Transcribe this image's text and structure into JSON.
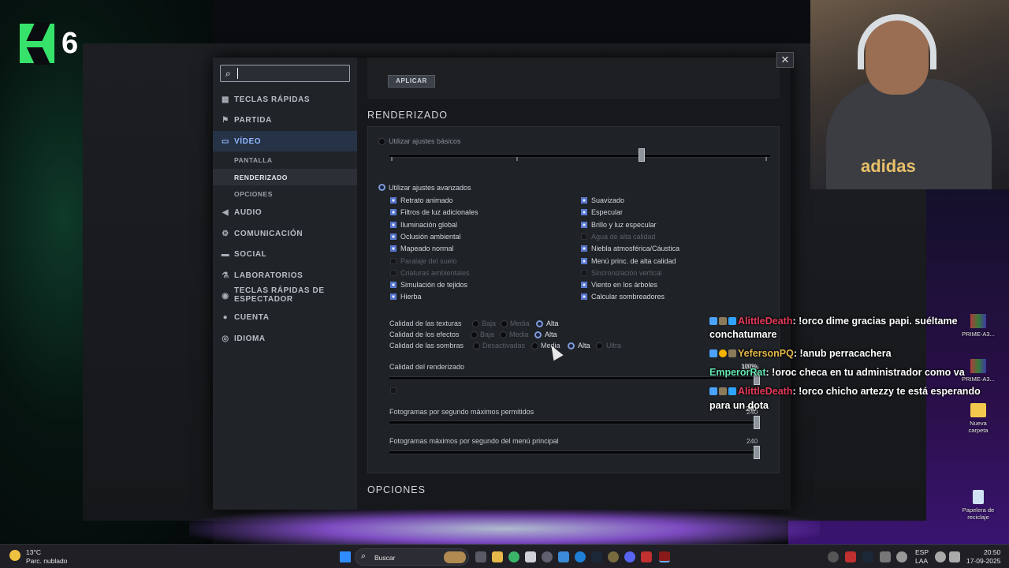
{
  "overlay": {
    "k_number": "6"
  },
  "window": {
    "close_glyph": "✕"
  },
  "sidebar": {
    "search": {
      "placeholder": "",
      "value": ""
    },
    "items": [
      {
        "label": "TECLAS RÁPIDAS",
        "icon": "grid-icon",
        "glyph": "▦"
      },
      {
        "label": "PARTIDA",
        "icon": "flag-icon",
        "glyph": "⚑"
      },
      {
        "label": "VÍDEO",
        "icon": "monitor-icon",
        "glyph": "▭"
      },
      {
        "label": "AUDIO",
        "icon": "speaker-icon",
        "glyph": "◀"
      },
      {
        "label": "COMUNICACIÓN",
        "icon": "gear-icon",
        "glyph": "⚙"
      },
      {
        "label": "SOCIAL",
        "icon": "chat-icon",
        "glyph": "▬"
      },
      {
        "label": "LABORATORIOS",
        "icon": "flask-icon",
        "glyph": "⚗"
      },
      {
        "label": "TECLAS RÁPIDAS DE",
        "label2": "ESPECTADOR",
        "icon": "eye-icon",
        "glyph": "◉"
      },
      {
        "label": "CUENTA",
        "icon": "user-icon",
        "glyph": "●"
      },
      {
        "label": "IDIOMA",
        "icon": "globe-icon",
        "glyph": "◎"
      }
    ],
    "video_sub": [
      "PANTALLA",
      "RENDERIZADO",
      "OPCIONES"
    ]
  },
  "main": {
    "apply_label": "APLICAR",
    "section_title": "RENDERIZADO",
    "next_section_title": "OPCIONES",
    "basic_label": "Utilizar ajustes básicos",
    "advanced_label": "Utilizar ajustes avanzados",
    "left_options": [
      {
        "label": "Retrato animado",
        "checked": true,
        "enabled": true
      },
      {
        "label": "Filtros de luz adicionales",
        "checked": true,
        "enabled": true
      },
      {
        "label": "Iluminación global",
        "checked": true,
        "enabled": true
      },
      {
        "label": "Oclusión ambiental",
        "checked": true,
        "enabled": true
      },
      {
        "label": "Mapeado normal",
        "checked": true,
        "enabled": true
      },
      {
        "label": "Paralaje del suelo",
        "checked": false,
        "enabled": false
      },
      {
        "label": "Criaturas ambientales",
        "checked": false,
        "enabled": false
      },
      {
        "label": "Simulación de tejidos",
        "checked": true,
        "enabled": true
      },
      {
        "label": "Hierba",
        "checked": true,
        "enabled": true
      }
    ],
    "right_options": [
      {
        "label": "Suavizado",
        "checked": true,
        "enabled": true
      },
      {
        "label": "Especular",
        "checked": true,
        "enabled": true
      },
      {
        "label": "Brillo y luz especular",
        "checked": true,
        "enabled": true
      },
      {
        "label": "Agua de alta calidad",
        "checked": false,
        "enabled": false
      },
      {
        "label": "Niebla atmosférica/Cáustica",
        "checked": true,
        "enabled": true
      },
      {
        "label": "Menú princ. de alta calidad",
        "checked": true,
        "enabled": true
      },
      {
        "label": "Sincronización vertical",
        "checked": false,
        "enabled": false
      },
      {
        "label": "Viento en los árboles",
        "checked": true,
        "enabled": true
      },
      {
        "label": "Calcular sombreadores",
        "checked": true,
        "enabled": true
      }
    ],
    "texture_quality": {
      "label": "Calidad de las texturas",
      "options": [
        "Baja",
        "Media",
        "Alta"
      ],
      "selected": "Alta"
    },
    "effects_quality": {
      "label": "Calidad de los efectos",
      "options": [
        "Baja",
        "Media",
        "Alta"
      ],
      "selected": "Alta"
    },
    "shadow_quality": {
      "label": "Calidad de las sombras",
      "options": [
        "Desactivadas",
        "Media",
        "Alta",
        "Ultra"
      ],
      "selected": "Alta"
    },
    "render_quality": {
      "label": "Calidad del renderizado",
      "value": "100%",
      "fraction": 1.0
    },
    "max_fps": {
      "label": "Fotogramas por segundo máximos permitidos",
      "value": "240",
      "fraction": 1.0
    },
    "menu_fps": {
      "label": "Fotogramas máximos por segundo del menú principal",
      "value": "240",
      "fraction": 1.0
    }
  },
  "chat": [
    {
      "user": "AlittleDeath",
      "text": ": !orco dime gracias papi. suéltame",
      "text2": "conchatumare"
    },
    {
      "user": "YefersonPQ",
      "text": ": !anub perracachera"
    },
    {
      "user": "EmperorRat",
      "text": ": !oroc checa en tu administrador como va"
    },
    {
      "user": "AlittleDeath",
      "text": ": !orco chicho artezzy te está esperando",
      "text2": "para un dota"
    }
  ],
  "overlay_numbers": {
    "n100": "100%",
    "n240a": "240"
  },
  "desktop": [
    {
      "label": "PRIME-A3..."
    },
    {
      "label": "PRIME-A3..."
    },
    {
      "label": "Nueva",
      "label2": "carpeta"
    },
    {
      "label": "Papelera de",
      "label2": "reciclaje"
    }
  ],
  "taskbar": {
    "weather_temp": "13°C",
    "weather_desc": "Parc. nublado",
    "search_label": "Buscar",
    "lang1": "ESP",
    "lang2": "LAA",
    "time": "20:50",
    "date": "17-09-2025"
  }
}
